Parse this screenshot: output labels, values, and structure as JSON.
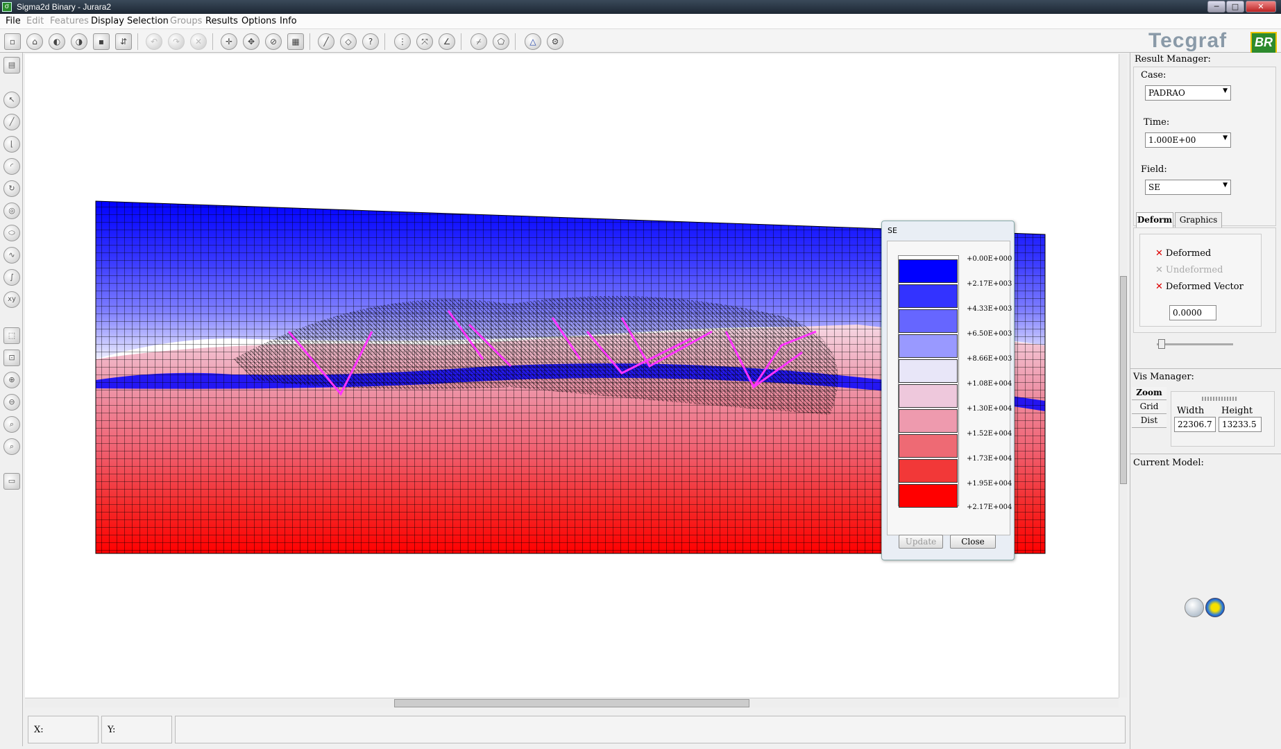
{
  "window": {
    "title": "Sigma2d Binary - Jurara2"
  },
  "menu": [
    {
      "label": "File",
      "enabled": true
    },
    {
      "label": "Edit",
      "enabled": false
    },
    {
      "label": "Features",
      "enabled": false
    },
    {
      "label": "Display",
      "enabled": true
    },
    {
      "label": "Selection",
      "enabled": true
    },
    {
      "label": "Groups",
      "enabled": false
    },
    {
      "label": "Results",
      "enabled": true
    },
    {
      "label": "Options",
      "enabled": true
    },
    {
      "label": "Info",
      "enabled": true
    }
  ],
  "logo": {
    "text": "Tecgraf",
    "badge": "BR"
  },
  "colors": {
    "mesh_top": "#0000ff",
    "mesh_bottom": "#ff0000",
    "fault": "#ff33ff",
    "panel_bg": "#f0f0f0"
  },
  "status": {
    "x_label": "X:",
    "y_label": "Y:"
  },
  "right_panel": {
    "result_manager": "Result Manager:",
    "case_label": "Case:",
    "case_value": "PADRAO",
    "time_label": "Time:",
    "time_value": "1.000E+00",
    "field_label": "Field:",
    "field_value": "SE",
    "tabs": [
      {
        "label": "Deform",
        "active": true
      },
      {
        "label": "Graphics",
        "active": false
      }
    ],
    "deform": {
      "deformed": "Deformed",
      "undeformed": "Undeformed",
      "deformed_vector": "Deformed Vector",
      "factor": "0.0000"
    },
    "vis_manager": "Vis Manager:",
    "vis_buttons": [
      "Zoom",
      "Grid",
      "Dist"
    ],
    "width_label": "Width",
    "height_label": "Height",
    "width_value": "22306.7",
    "height_value": "13233.5",
    "current_model": "Current Model:"
  },
  "legend": {
    "title": "SE",
    "ticks": [
      "+0.00E+000",
      "+2.17E+003",
      "+4.33E+003",
      "+6.50E+003",
      "+8.66E+003",
      "+1.08E+004",
      "+1.30E+004",
      "+1.52E+004",
      "+1.73E+004",
      "+1.95E+004",
      "+2.17E+004"
    ],
    "swatches": [
      "#0000ff",
      "#3333ff",
      "#6666ff",
      "#9999ff",
      "#e8e6f8",
      "#eec8dc",
      "#ee9aae",
      "#ee6a74",
      "#f23838",
      "#ff0000"
    ],
    "update_label": "Update",
    "close_label": "Close"
  }
}
